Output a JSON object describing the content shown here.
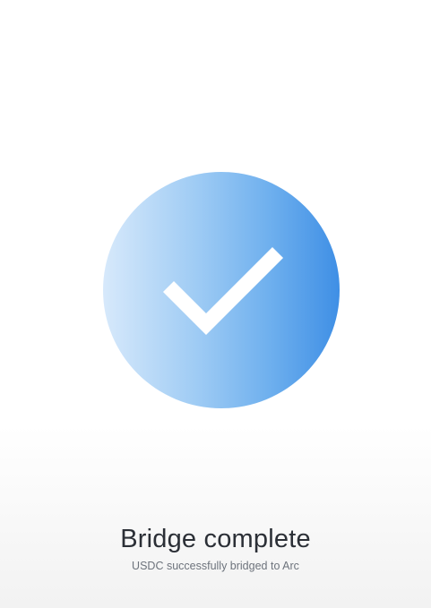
{
  "status": {
    "icon": "check-icon",
    "title": "Bridge complete",
    "message": "USDC successfully bridged to Arc"
  },
  "colors": {
    "badge_gradient_start": "#d7e9fb",
    "badge_gradient_end": "#3f8fe5",
    "check": "#ffffff",
    "title_text": "#2b2f36",
    "subtitle_text": "#6d737c"
  }
}
